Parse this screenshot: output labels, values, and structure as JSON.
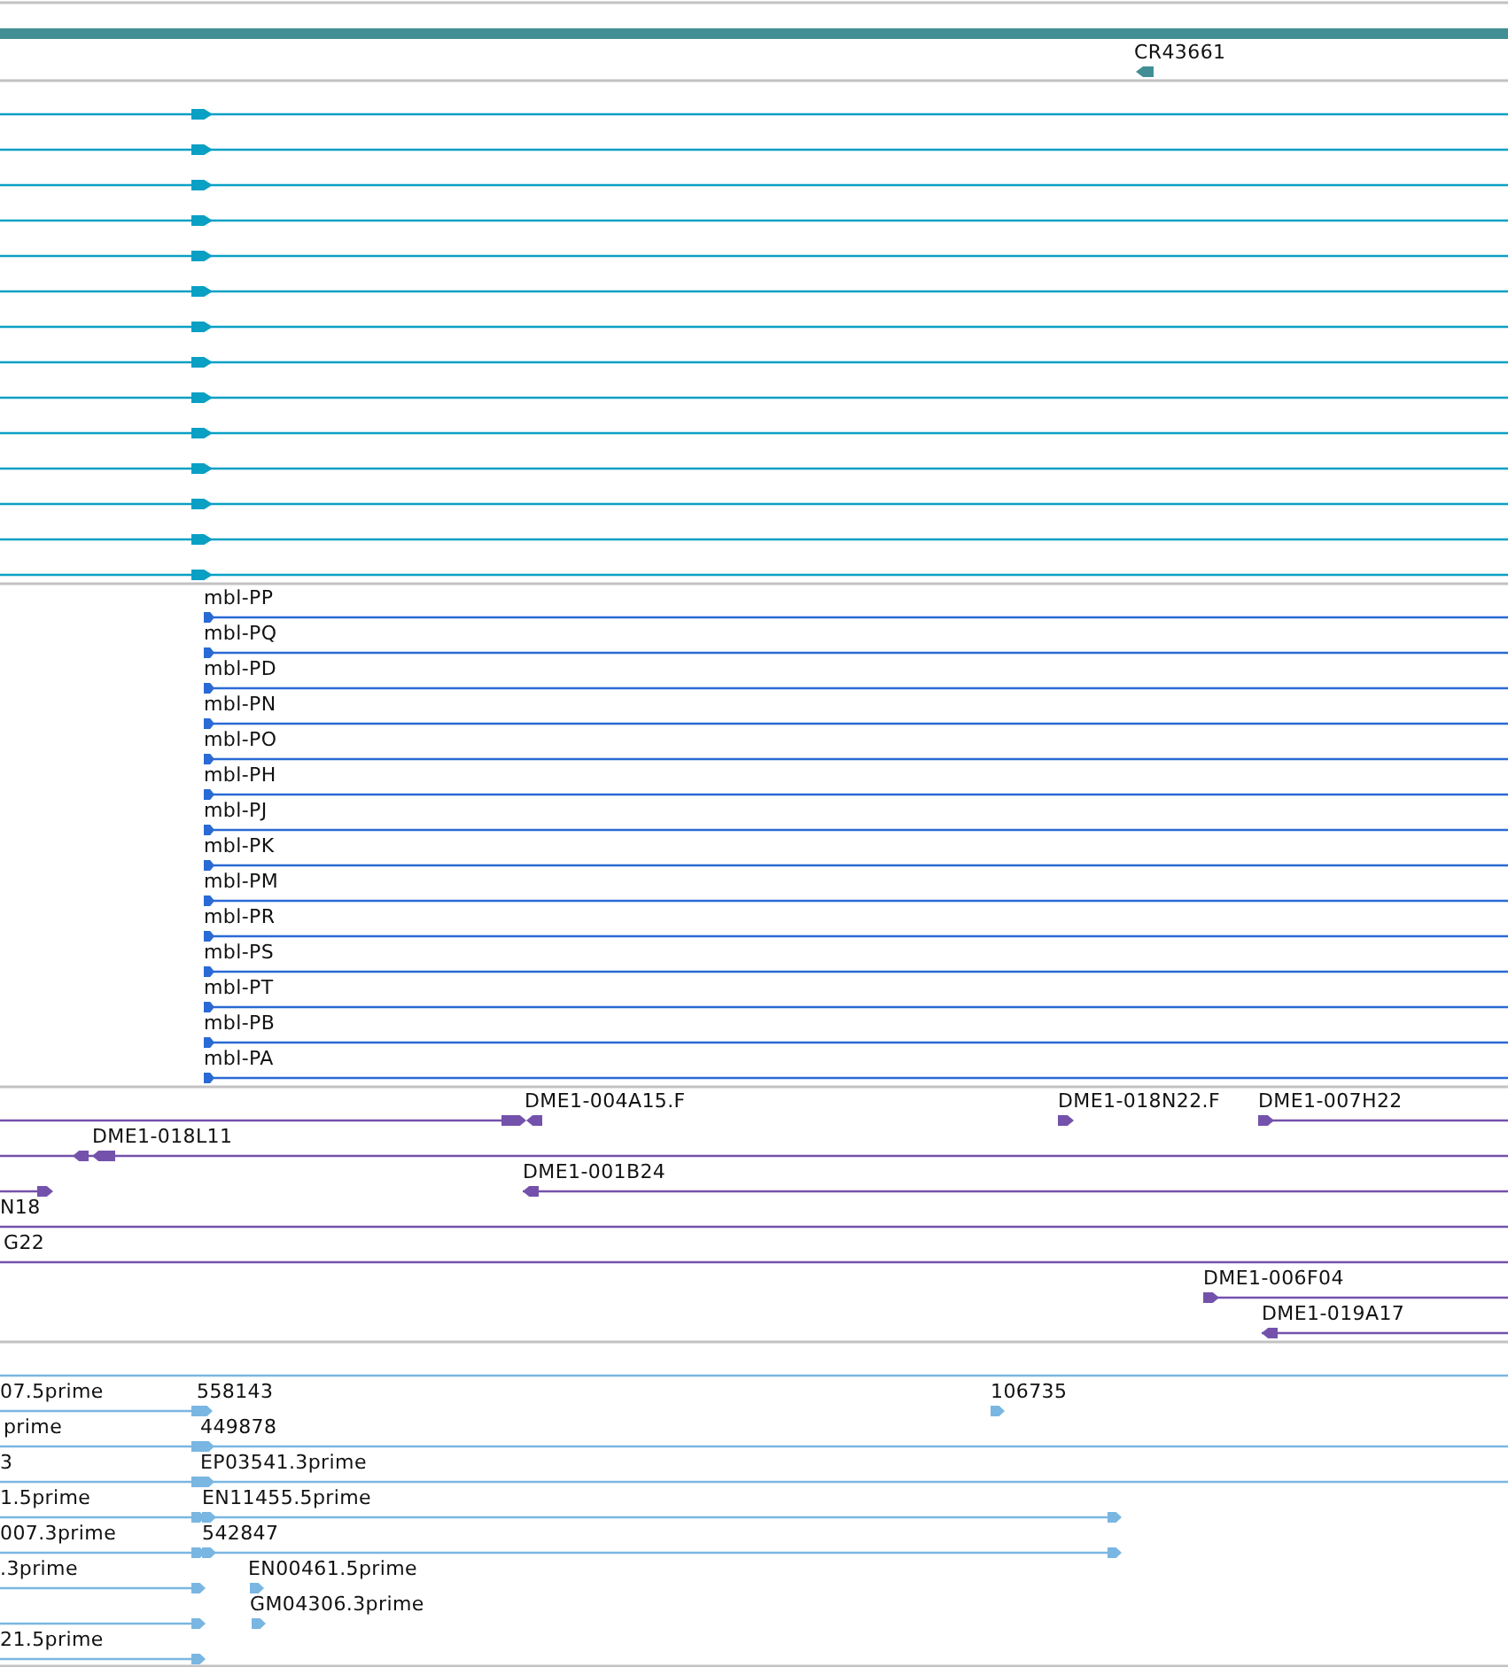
{
  "tracks": [
    {
      "kind": "gene",
      "features": [
        {
          "kind": "plain"
        },
        {
          "label": "CR43661",
          "kind": "reverse"
        }
      ]
    },
    {
      "kind": "transcript",
      "features": [
        {
          "kind": "forward"
        },
        {
          "kind": "forward"
        },
        {
          "kind": "forward"
        },
        {
          "kind": "forward"
        },
        {
          "kind": "forward"
        },
        {
          "kind": "forward"
        },
        {
          "kind": "forward"
        },
        {
          "kind": "forward"
        },
        {
          "kind": "forward"
        },
        {
          "kind": "forward"
        },
        {
          "kind": "forward"
        },
        {
          "kind": "forward"
        },
        {
          "kind": "forward"
        },
        {
          "kind": "forward"
        }
      ]
    },
    {
      "kind": "protein",
      "features": [
        {
          "label": "mbl-PP",
          "kind": "forward"
        },
        {
          "label": "mbl-PQ",
          "kind": "forward"
        },
        {
          "label": "mbl-PD",
          "kind": "forward"
        },
        {
          "label": "mbl-PN",
          "kind": "forward"
        },
        {
          "label": "mbl-PO",
          "kind": "forward"
        },
        {
          "label": "mbl-PH",
          "kind": "forward"
        },
        {
          "label": "mbl-PJ",
          "kind": "forward"
        },
        {
          "label": "mbl-PK",
          "kind": "forward"
        },
        {
          "label": "mbl-PM",
          "kind": "forward"
        },
        {
          "label": "mbl-PR",
          "kind": "forward"
        },
        {
          "label": "mbl-PS",
          "kind": "forward"
        },
        {
          "label": "mbl-PT",
          "kind": "forward"
        },
        {
          "label": "mbl-PB",
          "kind": "forward"
        },
        {
          "label": "mbl-PA",
          "kind": "forward"
        }
      ]
    },
    {
      "kind": "clone",
      "features": [
        {
          "kind": "forward"
        },
        {
          "label": "DME1-004A15.F",
          "kind": "reverse"
        },
        {
          "label": "DME1-018N22.F",
          "kind": "forward"
        },
        {
          "label": "DME1-007H22",
          "kind": "forward"
        },
        {
          "label": "DME1-018L11",
          "kind": "reverse"
        },
        {
          "kind": "forward"
        },
        {
          "label": "DME1-001B24",
          "kind": "reverse"
        },
        {
          "label": "N18",
          "kind": "plain"
        },
        {
          "label": "G22",
          "kind": "plain"
        },
        {
          "label": "DME1-006F04",
          "kind": "forward"
        },
        {
          "label": "DME1-019A17",
          "kind": "reverse"
        }
      ]
    },
    {
      "kind": "est",
      "features": [
        {
          "kind": "plain"
        },
        {
          "label": "07.5prime",
          "kind": "forward"
        },
        {
          "label": "558143",
          "kind": "forward"
        },
        {
          "label": "106735",
          "kind": "forward"
        },
        {
          "label": "prime",
          "kind": "forward"
        },
        {
          "label": "449878",
          "kind": "forward"
        },
        {
          "label": "3",
          "kind": "forward"
        },
        {
          "label": "EP03541.3prime",
          "kind": "forward"
        },
        {
          "label": "1.5prime",
          "kind": "forward"
        },
        {
          "label": "EN11455.5prime",
          "kind": "forward"
        },
        {
          "label": "007.3prime",
          "kind": "forward"
        },
        {
          "label": "542847",
          "kind": "forward"
        },
        {
          "label": ".3prime",
          "kind": "forward"
        },
        {
          "label": "EN00461.5prime",
          "kind": "forward"
        },
        {
          "kind": "forward"
        },
        {
          "label": "GM04306.3prime",
          "kind": "forward"
        },
        {
          "label": "21.5prime",
          "kind": "forward"
        }
      ]
    }
  ]
}
